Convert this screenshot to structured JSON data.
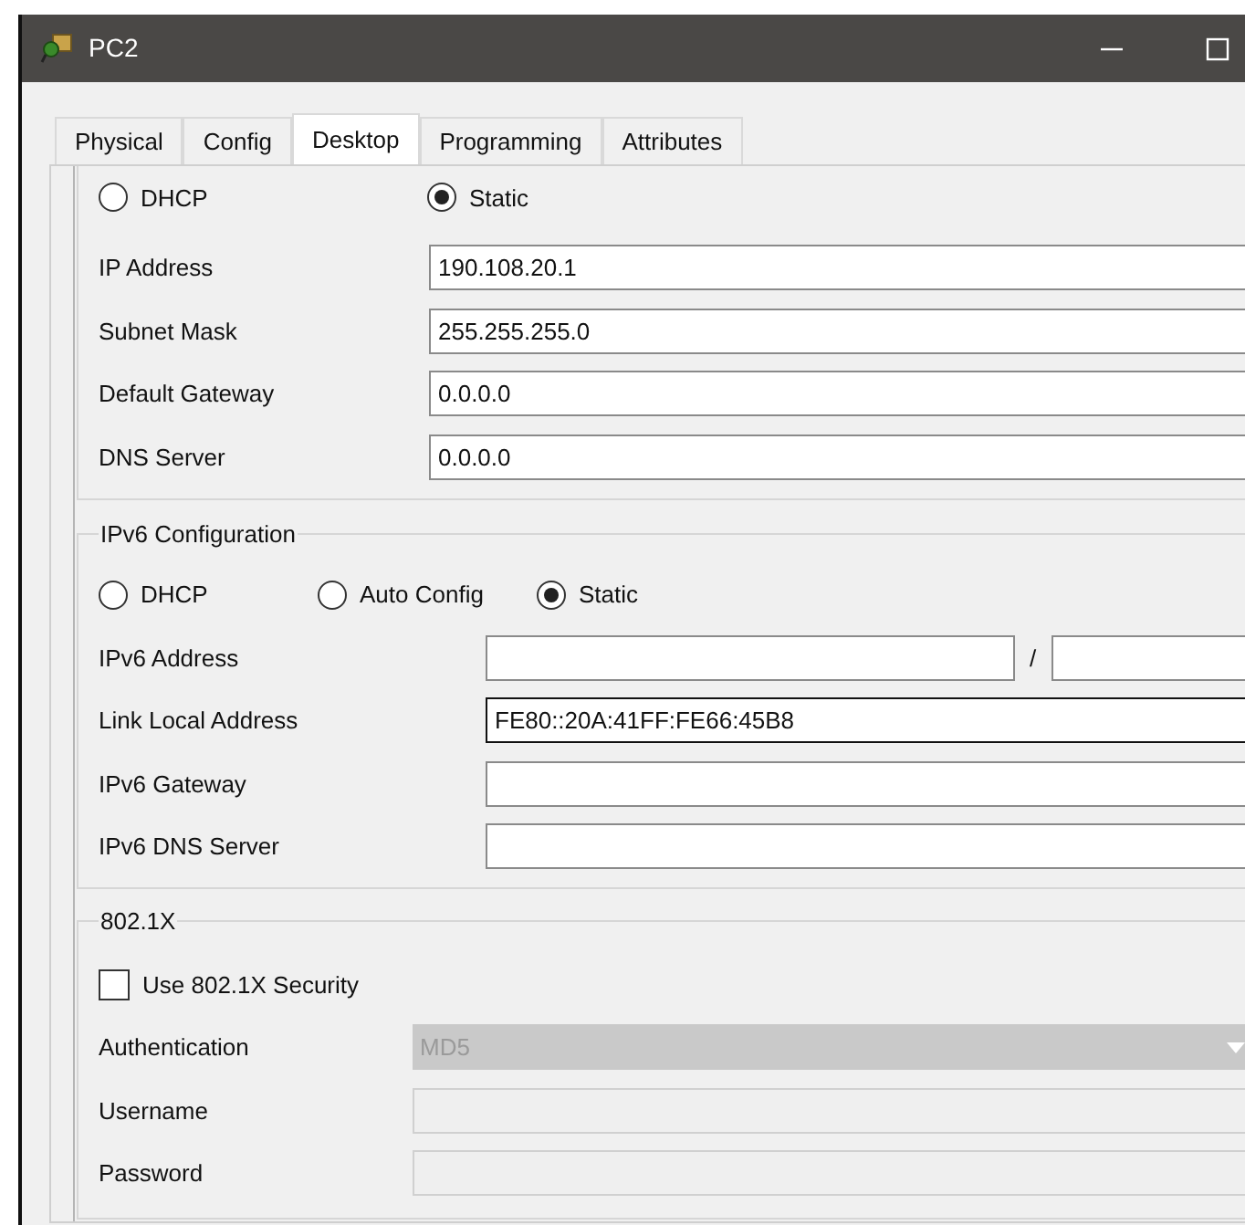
{
  "window": {
    "title": "PC2"
  },
  "tabs": [
    {
      "label": "Physical",
      "selected": false
    },
    {
      "label": "Config",
      "selected": false
    },
    {
      "label": "Desktop",
      "selected": true
    },
    {
      "label": "Programming",
      "selected": false
    },
    {
      "label": "Attributes",
      "selected": false
    }
  ],
  "ipv4": {
    "options": [
      {
        "label": "DHCP",
        "selected": false
      },
      {
        "label": "Static",
        "selected": true
      }
    ],
    "fields": [
      {
        "label": "IP Address",
        "value": "190.108.20.1"
      },
      {
        "label": "Subnet Mask",
        "value": "255.255.255.0"
      },
      {
        "label": "Default Gateway",
        "value": "0.0.0.0"
      },
      {
        "label": "DNS Server",
        "value": "0.0.0.0"
      }
    ]
  },
  "ipv6": {
    "title": "IPv6 Configuration",
    "options": [
      {
        "label": "DHCP",
        "selected": false
      },
      {
        "label": "Auto Config",
        "selected": false
      },
      {
        "label": "Static",
        "selected": true
      }
    ],
    "fields": [
      {
        "label": "IPv6 Address",
        "kind": "prefixed",
        "separator": "/",
        "focused": false
      },
      {
        "label": "Link Local Address",
        "value": "FE80::20A:41FF:FE66:45B8",
        "kind": "text",
        "focused": true
      },
      {
        "label": "IPv6 Gateway",
        "kind": "text",
        "focused": false
      },
      {
        "label": "IPv6 DNS Server",
        "kind": "text",
        "focused": false
      }
    ]
  },
  "dot1x": {
    "title": "802.1X",
    "checkbox": {
      "label": "Use 802.1X Security",
      "checked": false
    },
    "fields": [
      {
        "label": "Authentication",
        "value": "MD5",
        "kind": "select",
        "disabled": true
      },
      {
        "label": "Username",
        "kind": "text",
        "disabled": true
      },
      {
        "label": "Password",
        "kind": "text",
        "disabled": true
      }
    ]
  }
}
